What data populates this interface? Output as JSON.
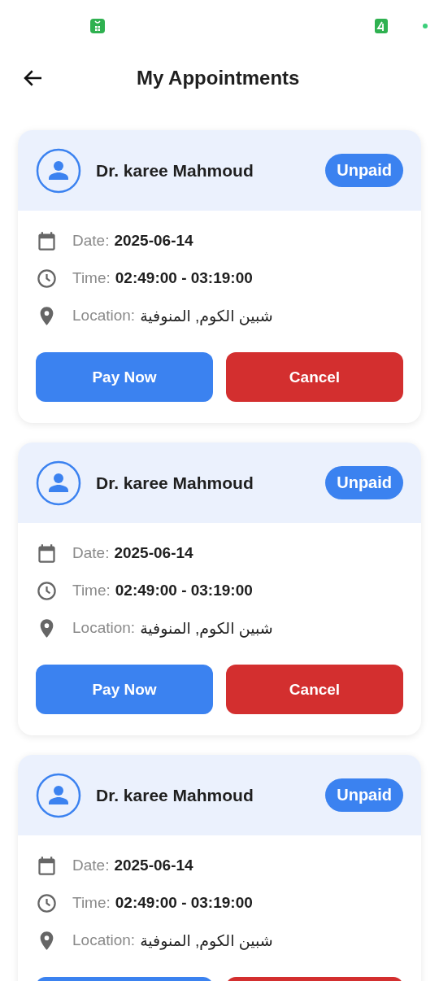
{
  "app_bar": {
    "title": "My Appointments"
  },
  "appointments": [
    {
      "doctor": "Dr. karee Mahmoud",
      "status": "Unpaid",
      "date_label": "Date:",
      "date": "2025-06-14",
      "time_label": "Time:",
      "time": "02:49:00 - 03:19:00",
      "location_label": "Location:",
      "location": "شبين الكوم, المنوفية",
      "actions": [
        {
          "kind": "pay",
          "label": "Pay Now"
        },
        {
          "kind": "cancel",
          "label": "Cancel"
        }
      ]
    },
    {
      "doctor": "Dr. karee Mahmoud",
      "status": "Unpaid",
      "date_label": "Date:",
      "date": "2025-06-14",
      "time_label": "Time:",
      "time": "02:49:00 - 03:19:00",
      "location_label": "Location:",
      "location": "شبين الكوم, المنوفية",
      "actions": [
        {
          "kind": "pay",
          "label": "Pay Now"
        },
        {
          "kind": "cancel",
          "label": "Cancel"
        }
      ]
    },
    {
      "doctor": "Dr. karee Mahmoud",
      "status": "Unpaid",
      "date_label": "Date:",
      "date": "2025-06-14",
      "time_label": "Time:",
      "time": "02:49:00 - 03:19:00",
      "location_label": "Location:",
      "location": "شبين الكوم, المنوفية",
      "actions": [
        {
          "kind": "pay"
        },
        {
          "kind": "cancel"
        }
      ]
    }
  ]
}
